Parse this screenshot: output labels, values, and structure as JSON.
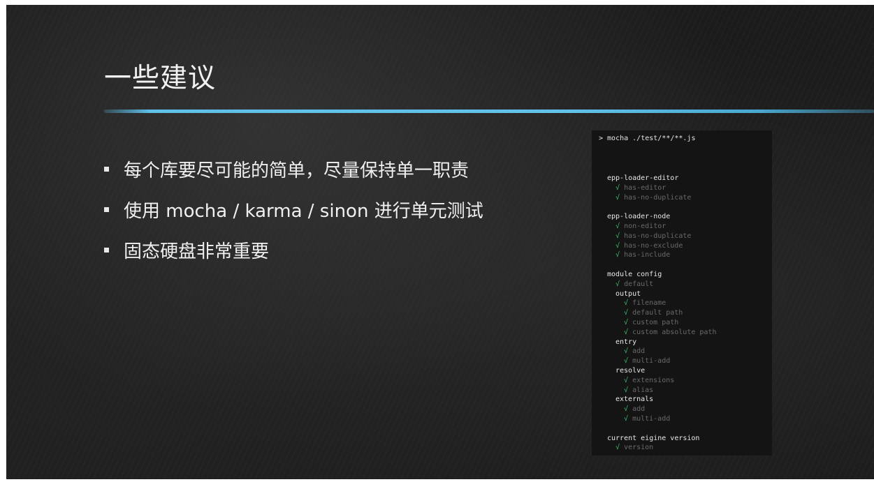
{
  "slide": {
    "title": "一些建议",
    "bullets": [
      "每个库要尽可能的简单，尽量保持单一职责",
      "使用 mocha / karma / sinon 进行单元测试",
      "固态硬盘非常重要"
    ]
  },
  "terminal": {
    "command": "> mocha ./test/**/**.js",
    "check_mark": "√",
    "lines": [
      {
        "type": "suite",
        "text": "epp-loader-editor",
        "indent": 1
      },
      {
        "type": "pass",
        "text": "has-editor",
        "indent": 2
      },
      {
        "type": "pass",
        "text": "has-no-duplicate",
        "indent": 2
      },
      {
        "type": "gap"
      },
      {
        "type": "suite",
        "text": "epp-loader-node",
        "indent": 1
      },
      {
        "type": "pass",
        "text": "non-editor",
        "indent": 2
      },
      {
        "type": "pass",
        "text": "has-no-duplicate",
        "indent": 2
      },
      {
        "type": "pass",
        "text": "has-no-exclude",
        "indent": 2
      },
      {
        "type": "pass",
        "text": "has-include",
        "indent": 2
      },
      {
        "type": "gap"
      },
      {
        "type": "suite",
        "text": "module config",
        "indent": 1
      },
      {
        "type": "pass",
        "text": "default",
        "indent": 2
      },
      {
        "type": "suite",
        "text": "output",
        "indent": 2
      },
      {
        "type": "pass",
        "text": "filename",
        "indent": 3
      },
      {
        "type": "pass",
        "text": "default path",
        "indent": 3
      },
      {
        "type": "pass",
        "text": "custom path",
        "indent": 3
      },
      {
        "type": "pass",
        "text": "custom absolute path",
        "indent": 3
      },
      {
        "type": "suite",
        "text": "entry",
        "indent": 2
      },
      {
        "type": "pass",
        "text": "add",
        "indent": 3
      },
      {
        "type": "pass",
        "text": "multi-add",
        "indent": 3
      },
      {
        "type": "suite",
        "text": "resolve",
        "indent": 2
      },
      {
        "type": "pass",
        "text": "extensions",
        "indent": 3
      },
      {
        "type": "pass",
        "text": "alias",
        "indent": 3
      },
      {
        "type": "suite",
        "text": "externals",
        "indent": 2
      },
      {
        "type": "pass",
        "text": "add",
        "indent": 3
      },
      {
        "type": "pass",
        "text": "multi-add",
        "indent": 3
      },
      {
        "type": "gap"
      },
      {
        "type": "suite",
        "text": "current eigine version",
        "indent": 1
      },
      {
        "type": "pass",
        "text": "version",
        "indent": 2
      }
    ]
  },
  "colors": {
    "background": "#1b1b1b",
    "accent_rule": "#62c2ea",
    "check": "#3fbf6a",
    "pass_text": "#6a6a6a"
  }
}
